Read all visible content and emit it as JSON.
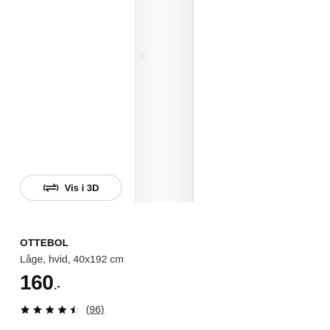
{
  "product": {
    "view3d_label": "Vis i 3D",
    "view3d_icon": "rotate-3d-icon",
    "name": "OTTEBOL",
    "description": "Låge, hvid, 40x192 cm",
    "price": "160",
    "price_suffix": ".-",
    "rating": {
      "value": 4.5,
      "max": 5,
      "review_count": "96",
      "review_display": "(96)",
      "star_color": "#111111"
    }
  }
}
